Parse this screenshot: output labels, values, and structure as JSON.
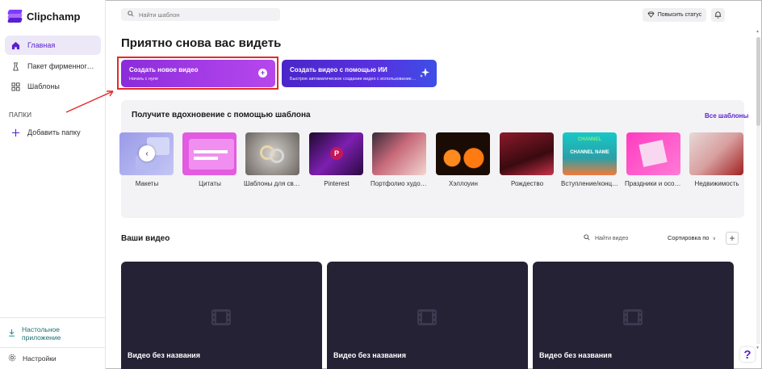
{
  "app": {
    "name": "Clipchamp"
  },
  "sidebar": {
    "items": [
      {
        "label": "Главная",
        "icon": "home-icon",
        "active": true
      },
      {
        "label": "Пакет фирменного стиля",
        "icon": "brand-kit-icon"
      },
      {
        "label": "Шаблоны",
        "icon": "templates-icon"
      }
    ],
    "folders_title": "ПАПКИ",
    "add_folder": "Добавить папку",
    "desktop_app": "Настольное приложение",
    "settings": "Настройки"
  },
  "topbar": {
    "search_placeholder": "Найти шаблон",
    "upgrade_label": "Повысить статус"
  },
  "main": {
    "heading": "Приятно снова вас видеть",
    "cta_new": {
      "title": "Создать новое видео",
      "subtitle": "Начать с нуля"
    },
    "cta_ai": {
      "title": "Создать видео с помощью ИИ",
      "subtitle": "Быстрое автоматическое создание видео с использованием ИИ"
    }
  },
  "templates": {
    "title": "Получите вдохновение с помощью шаблона",
    "all_link": "Все шаблоны",
    "items": [
      {
        "label": "Макеты"
      },
      {
        "label": "Цитаты"
      },
      {
        "label": "Шаблоны для свадьбы"
      },
      {
        "label": "Pinterest"
      },
      {
        "label": "Портфолио художника"
      },
      {
        "label": "Хэллоуин"
      },
      {
        "label": "Рождество"
      },
      {
        "label": "Вступление/концовка"
      },
      {
        "label": "Праздники и особые случаи"
      },
      {
        "label": "Недвижимость"
      }
    ],
    "thumb_texts": {
      "intro_1": "CHANNEL",
      "intro_2": "CHANNEL NAME"
    }
  },
  "videos": {
    "title": "Ваши видео",
    "search_placeholder": "Найти видео",
    "sort_label": "Сортировка по",
    "items": [
      {
        "title": "Видео без названия"
      },
      {
        "title": "Видео без названия"
      },
      {
        "title": "Видео без названия"
      }
    ]
  },
  "help_label": "?",
  "colors": {
    "accent": "#5a1fd1",
    "highlight": "#e32a2a",
    "video_bg": "#252235"
  }
}
